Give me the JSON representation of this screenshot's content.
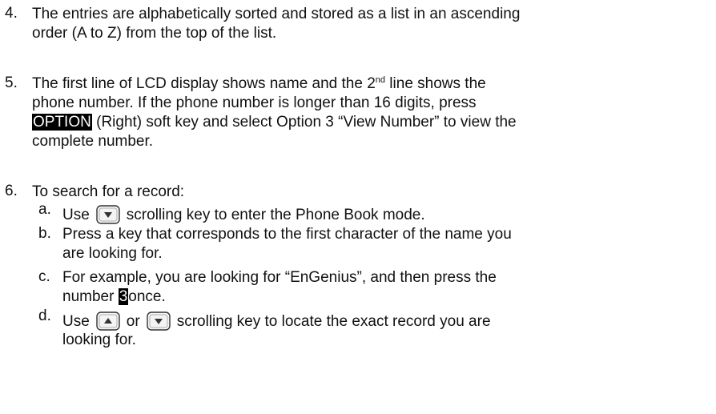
{
  "items": [
    {
      "number": "4.",
      "lines": [
        "The entries are alphabetically sorted and stored as a list in an ascending",
        "order (A to Z) from the top of the list."
      ]
    },
    {
      "number": "5.",
      "line1a": "The first line of LCD display shows name and the 2",
      "line1_sup": "nd",
      "line1b": " line shows the",
      "line2": "phone number.  If the phone number is longer than 16 digits, press",
      "option_key": "OPTION",
      "line3_rest": " (Right) soft key and select Option 3 “View Number” to view the",
      "line4": "complete number."
    },
    {
      "number": "6.",
      "intro": "To search for a record:",
      "steps": {
        "a": {
          "letter": "a.",
          "before": "Use",
          "icon": "down-arrow-key-icon",
          "after": "scrolling key to enter the Phone Book mode."
        },
        "b": {
          "letter": "b.",
          "line1": "Press a key that corresponds to the first character of the name you",
          "line2": "are looking for."
        },
        "c": {
          "letter": "c.",
          "line1": "For example, you are looking for “EnGenius”, and then press the",
          "line2_before": "number ",
          "key": "3",
          "line2_after": "once."
        },
        "d": {
          "letter": "d.",
          "before": "Use",
          "icon_up": "up-arrow-key-icon",
          "or": "or",
          "icon_down": "down-arrow-key-icon",
          "after": "scrolling key to locate the exact record you are",
          "line2": "looking for."
        }
      }
    }
  ]
}
